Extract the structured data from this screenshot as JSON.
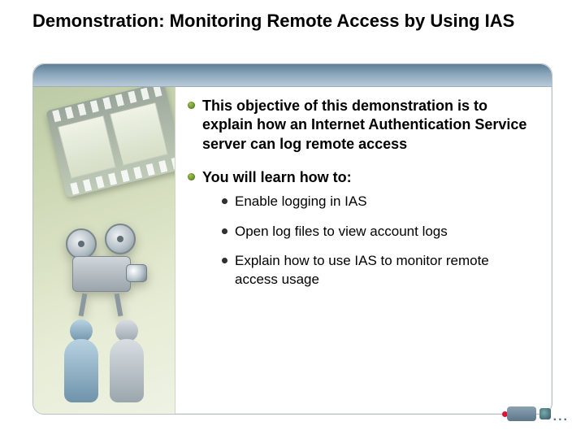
{
  "title": "Demonstration: Monitoring Remote Access by Using IAS",
  "bullets": {
    "b1": "This objective of this demonstration is to explain how an Internet Authentication Service server can log remote access",
    "b2": "You will learn how to:",
    "subs": {
      "s1": "Enable logging in IAS",
      "s2": "Open log files to view account logs",
      "s3": "Explain how to use IAS to monitor remote access usage"
    }
  },
  "icons": {
    "camcorder_ellipsis": "..."
  }
}
